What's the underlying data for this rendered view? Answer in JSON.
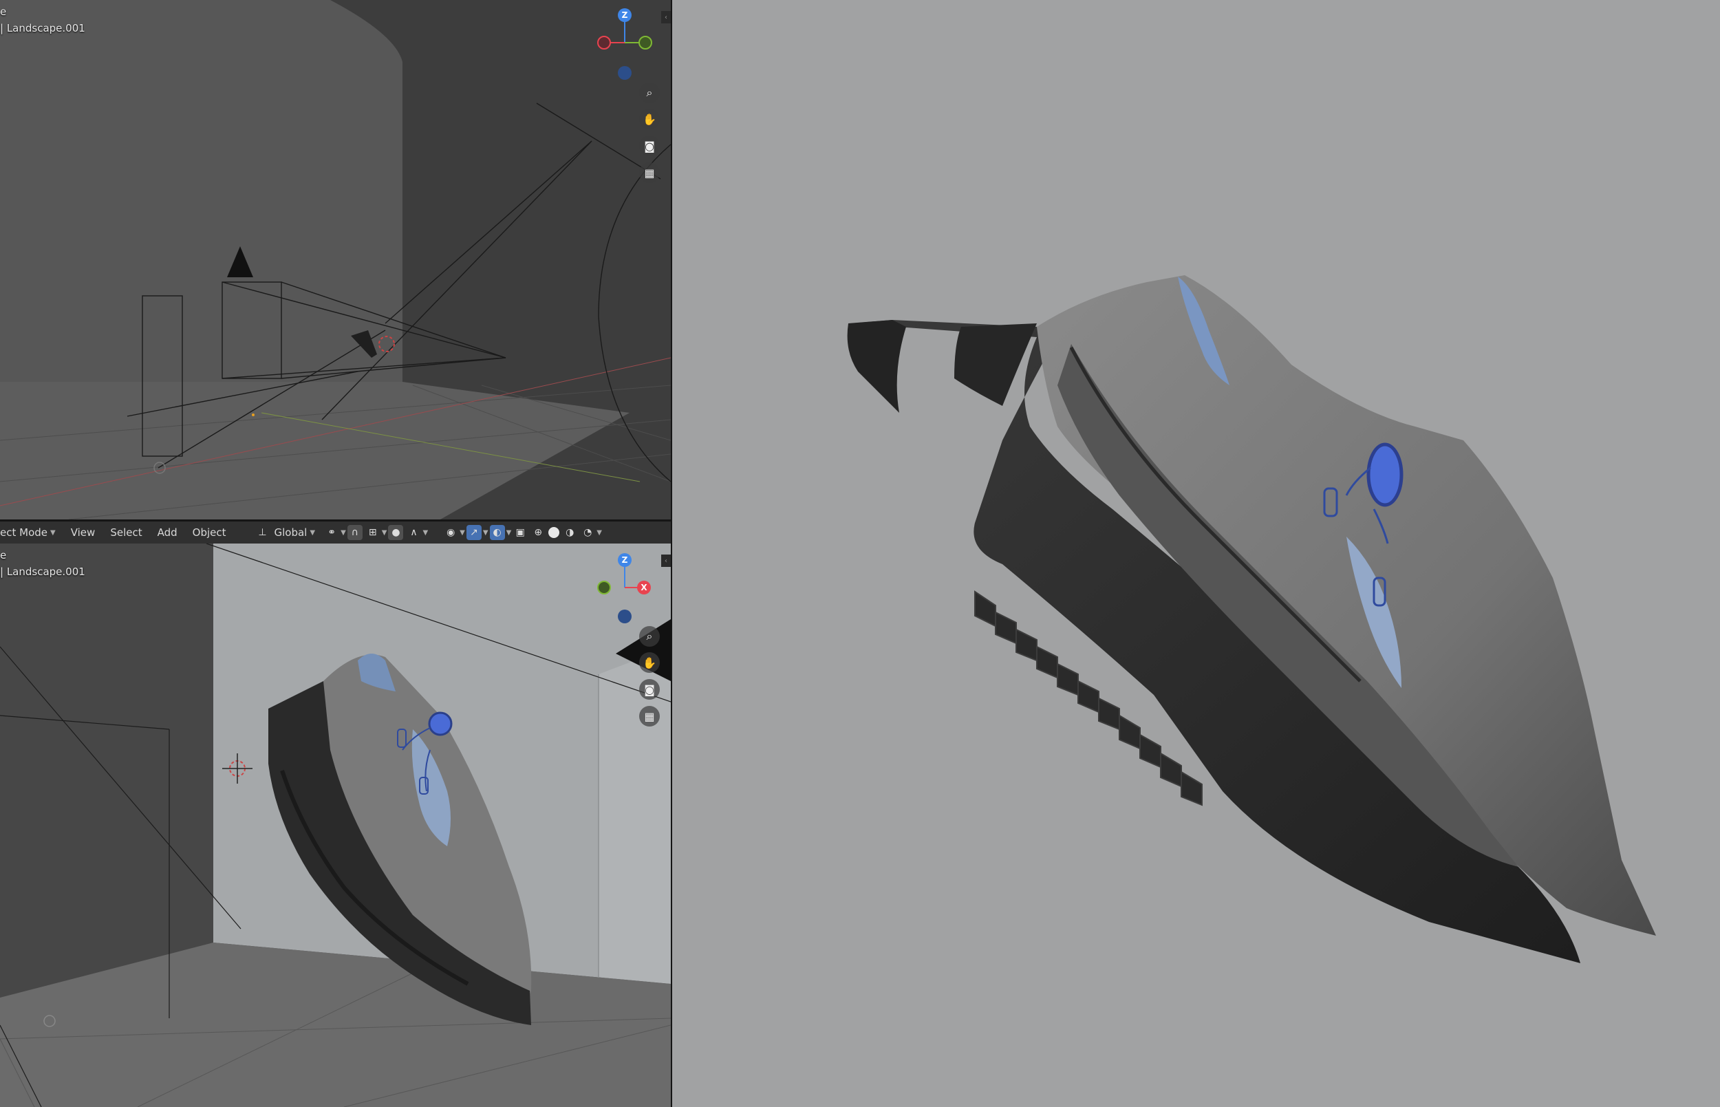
{
  "viewport_top": {
    "overlay_line1": "e",
    "overlay_line2": "| Landscape.001",
    "gizmo": {
      "z": "Z"
    }
  },
  "viewport_bottom": {
    "overlay_line1": "e",
    "overlay_line2": "| Landscape.001",
    "gizmo": {
      "z": "Z",
      "x": "X"
    }
  },
  "header": {
    "mode": "ect Mode",
    "menus": [
      "View",
      "Select",
      "Add",
      "Object"
    ],
    "transform_orientation": "Global"
  },
  "colors": {
    "axis_x": "#e8434f",
    "axis_y": "#7fb834",
    "axis_z": "#3f86e8",
    "accent": "#4772b3",
    "shoe_blue": "#4a6bd6"
  }
}
